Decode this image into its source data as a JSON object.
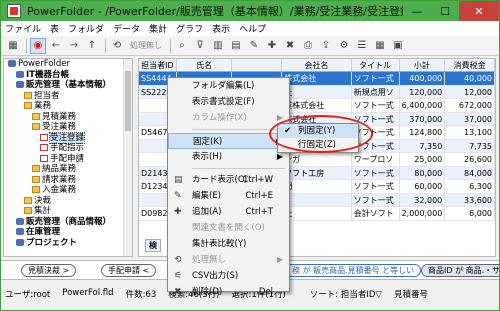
{
  "window": {
    "title": "PowerFolder - /PowerFolder/販売管理（基本情報）/業務/受注業務/受注登録",
    "min": "—",
    "max": "☐",
    "close": "✕"
  },
  "menubar": [
    "ファイル",
    "表",
    "フォルダ",
    "データ",
    "集計",
    "グラフ",
    "表示",
    "ヘルプ"
  ],
  "toolbar": {
    "disabled_action": "処理無し"
  },
  "tree": [
    {
      "label": "PowerFolder",
      "type": "db",
      "indent": 0,
      "bold": false
    },
    {
      "label": "IT機器台帳",
      "type": "db",
      "indent": 1,
      "bold": true
    },
    {
      "label": "販売管理（基本情報）",
      "type": "db",
      "indent": 1,
      "bold": true
    },
    {
      "label": "担当者",
      "type": "folder",
      "indent": 2,
      "bold": false
    },
    {
      "label": "業務",
      "type": "folder",
      "indent": 2,
      "bold": false
    },
    {
      "label": "見積業務",
      "type": "folder",
      "indent": 3,
      "bold": false
    },
    {
      "label": "受注業務",
      "type": "folder",
      "indent": 3,
      "bold": false
    },
    {
      "label": "受注登録",
      "type": "doc",
      "indent": 4,
      "bold": false,
      "selected": true
    },
    {
      "label": "手配指示",
      "type": "doc",
      "indent": 4,
      "bold": false
    },
    {
      "label": "手配申請",
      "type": "doc",
      "indent": 4,
      "bold": false
    },
    {
      "label": "納品業務",
      "type": "folder",
      "indent": 3,
      "bold": false
    },
    {
      "label": "請求業務",
      "type": "folder",
      "indent": 3,
      "bold": false
    },
    {
      "label": "入金業務",
      "type": "folder",
      "indent": 3,
      "bold": false
    },
    {
      "label": "決裁",
      "type": "folder",
      "indent": 2,
      "bold": false
    },
    {
      "label": "集計",
      "type": "folder",
      "indent": 2,
      "bold": false
    },
    {
      "label": "販売管理（商品情報）",
      "type": "db",
      "indent": 1,
      "bold": true
    },
    {
      "label": "在庫管理",
      "type": "db",
      "indent": 1,
      "bold": true
    },
    {
      "label": "プロジェクト",
      "type": "db",
      "indent": 1,
      "bold": true
    }
  ],
  "grid": {
    "headers": [
      "担当者ID",
      "氏名",
      "",
      "会社名",
      "タイトル",
      "小計",
      "消費税金"
    ],
    "rows": [
      [
        "SS4444",
        "",
        "",
        "株式会社",
        "ソフト一式",
        "400,000",
        "40,000"
      ],
      [
        "SS2222",
        "",
        "",
        "社",
        "新規点用ソ",
        "120,000",
        "12,000"
      ],
      [
        "",
        "",
        "",
        "業株式会社",
        "ソフト一式",
        "6,400,000",
        "672,000"
      ],
      [
        "",
        "",
        "",
        "株式会社",
        "ソフト一式",
        "370,000",
        "37,000"
      ],
      [
        "D5467",
        "",
        "",
        "",
        "ソフト一式",
        "124,800",
        "13,100"
      ],
      [
        "",
        "",
        "",
        "",
        "ソフト一式",
        "7,350",
        "7,735"
      ],
      [
        "",
        "",
        "",
        "ンガ",
        "ワープロソ",
        "25,000",
        "26,600"
      ],
      [
        "D2143",
        "",
        "",
        "ソフト工房",
        "ソフト一式",
        "80,000",
        "84,000"
      ],
      [
        "D1234",
        "",
        "",
        "門",
        "ソフト一式",
        "60,000",
        "6,300"
      ],
      [
        "",
        "",
        "",
        "",
        "ソフト一式",
        "32,000",
        "33,600"
      ],
      [
        "D0982",
        "",
        "",
        "社",
        "会計ソフト",
        "2,000,000",
        "6,000"
      ]
    ],
    "tab_label": "検"
  },
  "context_menu": [
    {
      "label": "フォルダ編集(L)",
      "shortcut": "",
      "icon": "",
      "disabled": false
    },
    {
      "label": "表示書式設定(F)",
      "shortcut": "",
      "icon": "",
      "disabled": false
    },
    {
      "label": "カラム操作(X)",
      "shortcut": "",
      "icon": "",
      "disabled": true,
      "submenu": true
    },
    {
      "sep": true
    },
    {
      "label": "固定(K)",
      "shortcut": "",
      "icon": "",
      "disabled": false,
      "submenu": true,
      "active": true
    },
    {
      "label": "表示(H)",
      "shortcut": "",
      "icon": "",
      "disabled": false,
      "submenu": true
    },
    {
      "sep": true
    },
    {
      "label": "カード表示(C)",
      "shortcut": "Ctrl+W",
      "icon": "▤",
      "disabled": false
    },
    {
      "label": "編集(E)",
      "shortcut": "Ctrl+E",
      "icon": "✎",
      "disabled": false
    },
    {
      "label": "追加(A)",
      "shortcut": "Ctrl+T",
      "icon": "✚",
      "disabled": false
    },
    {
      "label": "関連文書を開く(O)",
      "shortcut": "",
      "icon": "",
      "disabled": true
    },
    {
      "label": "集計表比較(Y)",
      "shortcut": "",
      "icon": "",
      "disabled": false
    },
    {
      "label": "処理無し",
      "shortcut": "",
      "icon": "⟲",
      "disabled": true,
      "submenu": true
    },
    {
      "label": "CSV出力(S)",
      "shortcut": "",
      "icon": "⚟",
      "disabled": false
    },
    {
      "label": "削除(D)",
      "shortcut": "Del",
      "icon": "✖",
      "disabled": false
    }
  ],
  "submenu": [
    {
      "label": "列固定(Y)",
      "checked": true
    },
    {
      "label": "行固定(Z)",
      "checked": false
    }
  ],
  "filters": [
    {
      "label": "見積決裁 >",
      "style": ""
    },
    {
      "label": "手配申請 <",
      "style": ""
    },
    {
      "label": "務 が 販売商品.見積番号 と等しい",
      "style": "blue"
    },
    {
      "label": "商品ID が 商品.・サ",
      "style": "dark"
    }
  ],
  "status": {
    "user": "ユーザ:root",
    "file": "PowerFol.fld",
    "count": "件数:63",
    "search": "検索:46(3行)",
    "selected": "選択:1件(1行)",
    "sort": "ソート: 担当者ID▽",
    "sort2": "見積番号"
  }
}
